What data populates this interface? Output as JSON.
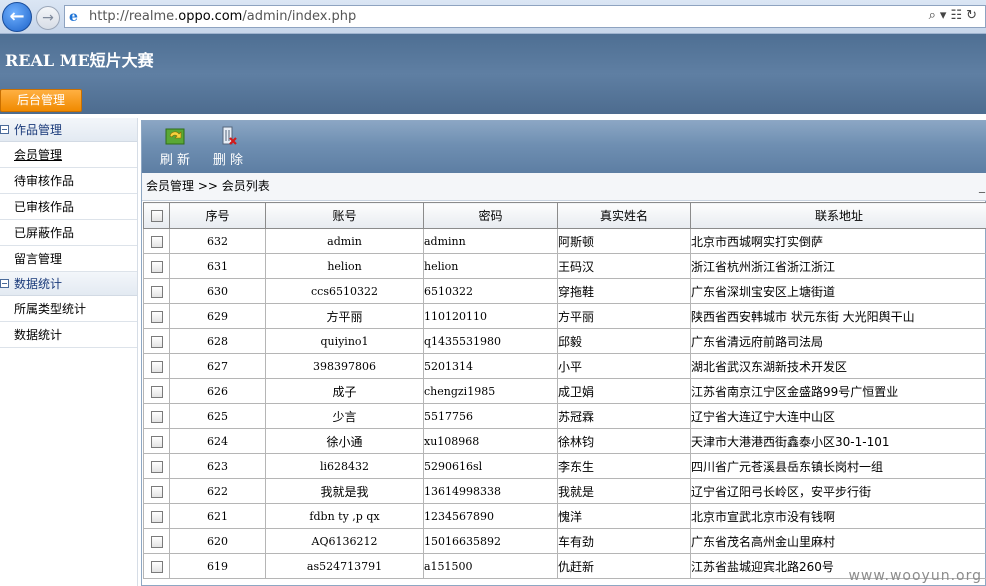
{
  "browser": {
    "url_prefix": "http://realme.",
    "url_domain": "oppo.com",
    "url_suffix": "/admin/index.php"
  },
  "header": {
    "title": "REAL ME短片大赛",
    "admin_button": "后台管理"
  },
  "sidebar": {
    "group1": "作品管理",
    "items1": [
      "会员管理",
      "待审核作品",
      "已审核作品",
      "已屏蔽作品",
      "留言管理"
    ],
    "group2": "数据统计",
    "items2": [
      "所属类型统计",
      "数据统计"
    ]
  },
  "toolbar": {
    "refresh": "刷 新",
    "delete": "删 除"
  },
  "breadcrumb": "会员管理 >> 会员列表",
  "table": {
    "headers": [
      "序号",
      "账号",
      "密码",
      "真实姓名",
      "联系地址"
    ],
    "rows": [
      [
        "632",
        "admin",
        "adminn",
        "阿斯顿",
        "北京市西城啊实打实倒萨"
      ],
      [
        "631",
        "helion",
        "helion",
        "王码汉",
        "浙江省杭州浙江省浙江浙江"
      ],
      [
        "630",
        "ccs6510322",
        "6510322",
        "穿拖鞋",
        "广东省深圳宝安区上塘街道"
      ],
      [
        "629",
        "方平丽",
        "110120110",
        "方平丽",
        "陕西省西安韩城市 状元东街 大光阳舆干山"
      ],
      [
        "628",
        "quiyino1",
        "q1435531980",
        "邱毅",
        "广东省清远府前路司法局"
      ],
      [
        "627",
        "398397806",
        "5201314",
        "小平",
        "湖北省武汉东湖新技术开发区"
      ],
      [
        "626",
        "成子",
        "chengzi1985",
        "成卫娟",
        "江苏省南京江宁区金盛路99号广恒置业"
      ],
      [
        "625",
        "少言",
        "5517756",
        "苏冠霖",
        "辽宁省大连辽宁大连中山区"
      ],
      [
        "624",
        "徐小通",
        "xu108968",
        "徐林钧",
        "天津市大港港西街鑫泰小区30-1-101"
      ],
      [
        "623",
        "li628432",
        "5290616sl",
        "李东生",
        "四川省广元苍溪县岳东镇长岗村一组"
      ],
      [
        "622",
        "我就是我",
        "13614998338",
        "我就是",
        "辽宁省辽阳弓长岭区，安平步行街"
      ],
      [
        "621",
        "fdbn ty ,p qx",
        "1234567890",
        "愧洋",
        "北京市宣武北京市没有钱啊"
      ],
      [
        "620",
        "AQ6136212",
        "15016635892",
        "车有劲",
        "广东省茂名高州金山里麻村"
      ],
      [
        "619",
        "as524713791",
        "a151500",
        "仇赶新",
        "江苏省盐城迎宾北路260号"
      ]
    ]
  },
  "watermark": "www.wooyun.org"
}
